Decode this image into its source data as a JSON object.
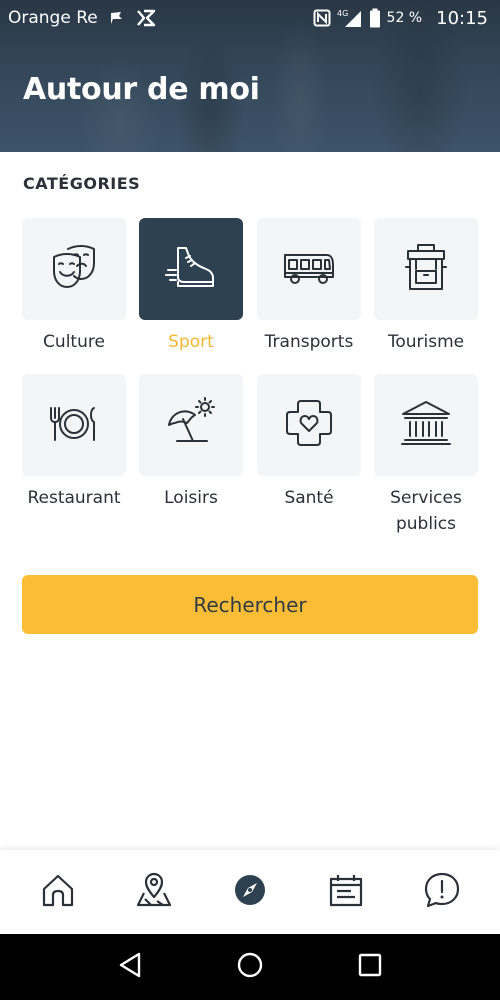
{
  "status_bar": {
    "carrier": "Orange Re",
    "network": "4G",
    "battery": "52 %",
    "time": "10:15"
  },
  "header": {
    "title": "Autour de moi"
  },
  "categories": {
    "section_title": "CATÉGORIES",
    "items": [
      {
        "label": "Culture",
        "icon": "theater-masks-icon",
        "selected": false
      },
      {
        "label": "Sport",
        "icon": "running-shoe-icon",
        "selected": true
      },
      {
        "label": "Transports",
        "icon": "bus-icon",
        "selected": false
      },
      {
        "label": "Tourisme",
        "icon": "backpack-icon",
        "selected": false
      },
      {
        "label": "Restaurant",
        "icon": "plate-cutlery-icon",
        "selected": false
      },
      {
        "label": "Loisirs",
        "icon": "beach-umbrella-icon",
        "selected": false
      },
      {
        "label": "Santé",
        "icon": "health-cross-heart-icon",
        "selected": false
      },
      {
        "label": "Services publics",
        "icon": "public-building-icon",
        "selected": false
      }
    ]
  },
  "search_button": {
    "label": "Rechercher"
  },
  "bottom_nav": {
    "items": [
      {
        "icon": "home-icon"
      },
      {
        "icon": "map-pin-icon"
      },
      {
        "icon": "compass-icon",
        "active": true
      },
      {
        "icon": "calendar-icon"
      },
      {
        "icon": "alert-chat-icon"
      }
    ]
  },
  "colors": {
    "header_dark": "#2e4151",
    "accent_yellow": "#fbbd36",
    "selected_label": "#f2b72e",
    "tile_bg": "#f4f5f7"
  }
}
